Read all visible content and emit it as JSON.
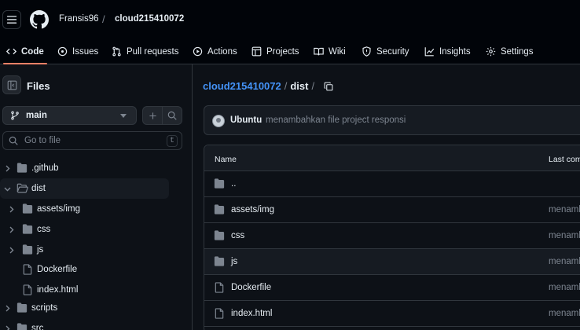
{
  "header": {
    "owner": "Fransis96",
    "separator": "/",
    "repo": "cloud215410072"
  },
  "nav": {
    "tabs": [
      {
        "label": "Code",
        "icon": "code-icon",
        "active": true
      },
      {
        "label": "Issues",
        "icon": "issue-icon"
      },
      {
        "label": "Pull requests",
        "icon": "pull-request-icon"
      },
      {
        "label": "Actions",
        "icon": "play-icon"
      },
      {
        "label": "Projects",
        "icon": "table-icon"
      },
      {
        "label": "Wiki",
        "icon": "book-icon"
      },
      {
        "label": "Security",
        "icon": "shield-icon"
      },
      {
        "label": "Insights",
        "icon": "graph-icon"
      },
      {
        "label": "Settings",
        "icon": "gear-icon"
      }
    ]
  },
  "sidebar": {
    "title": "Files",
    "branch": "main",
    "goto_placeholder": "Go to file",
    "goto_shortcut": "t",
    "tree": [
      {
        "label": ".github",
        "type": "folder",
        "expanded": false
      },
      {
        "label": "dist",
        "type": "folder",
        "expanded": true,
        "selected": true
      },
      {
        "label": "assets/img",
        "type": "folder",
        "expanded": false
      },
      {
        "label": "css",
        "type": "folder",
        "expanded": false
      },
      {
        "label": "js",
        "type": "folder",
        "expanded": false
      },
      {
        "label": "Dockerfile",
        "type": "file"
      },
      {
        "label": "index.html",
        "type": "file"
      },
      {
        "label": "scripts",
        "type": "folder",
        "expanded": false
      },
      {
        "label": "src",
        "type": "folder",
        "expanded": false
      }
    ]
  },
  "main": {
    "breadcrumb": {
      "repo": "cloud215410072",
      "sep": "/",
      "current": "dist",
      "trailing": "/"
    },
    "commit": {
      "author": "Ubuntu",
      "message": "menambahkan file project responsi"
    },
    "table": {
      "col_name": "Name",
      "col_commit": "Last commit message",
      "rows": [
        {
          "name": "..",
          "type": "folder",
          "commit": ""
        },
        {
          "name": "assets/img",
          "type": "folder",
          "commit": "menambahkan file project responsi"
        },
        {
          "name": "css",
          "type": "folder",
          "commit": "menambahkan file project responsi"
        },
        {
          "name": "js",
          "type": "folder",
          "commit": "menambahkan file project responsi"
        },
        {
          "name": "Dockerfile",
          "type": "file",
          "commit": "menambahkan file project responsi"
        },
        {
          "name": "index.html",
          "type": "file",
          "commit": "menambahkan file project responsi"
        }
      ]
    }
  },
  "colors": {
    "background": "#0d1117",
    "header_bg": "#010409",
    "border": "#30363d",
    "link": "#4493f8",
    "active_tab_underline": "#f78166",
    "muted_text": "#7d8590"
  }
}
